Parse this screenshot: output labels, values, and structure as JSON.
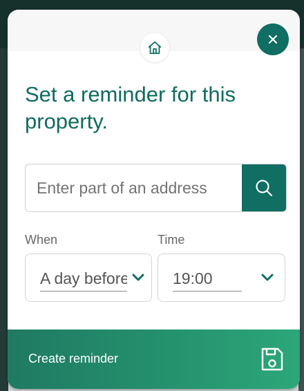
{
  "header": {
    "home_icon": "home-icon",
    "close_icon": "close-icon"
  },
  "title": "Set a reminder for this property.",
  "search": {
    "placeholder": "Enter part of an address",
    "value": "",
    "icon": "search-icon"
  },
  "when": {
    "label": "When",
    "selected": "A day before"
  },
  "time": {
    "label": "Time",
    "selected": "19:00"
  },
  "footer": {
    "label": "Create reminder",
    "icon": "save-icon"
  },
  "colors": {
    "accent": "#106e63",
    "title": "#0f6b60",
    "footer_start": "#1f7a62",
    "footer_end": "#2ca77a"
  }
}
